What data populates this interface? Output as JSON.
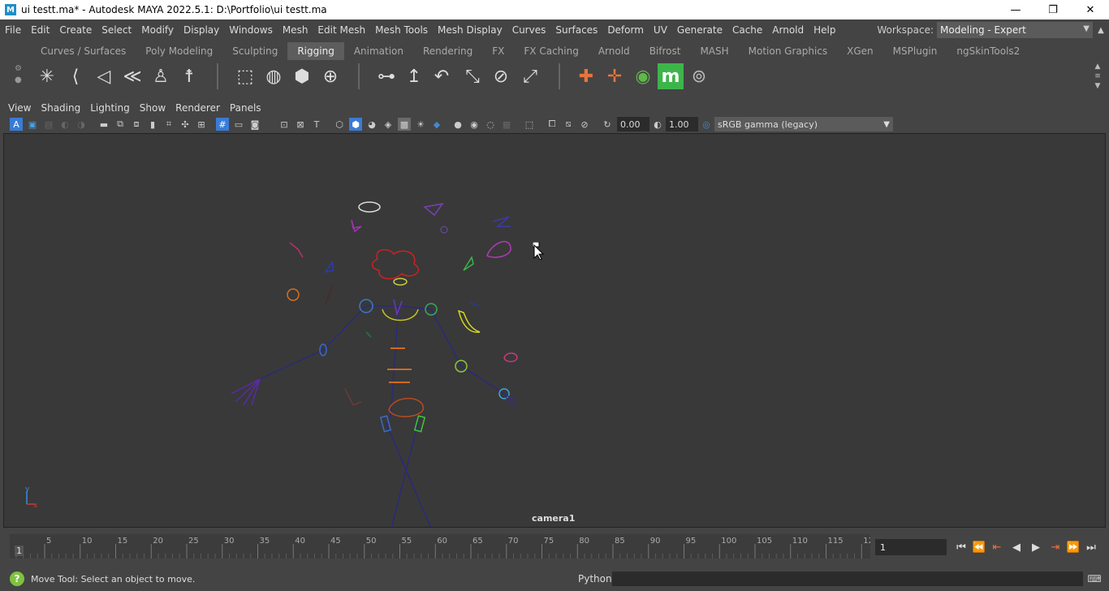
{
  "window": {
    "app_icon": "M",
    "title": "ui testt.ma* - Autodesk MAYA 2022.5.1: D:\\Portfolio\\ui testt.ma",
    "minimize": "—",
    "restore": "❐",
    "close": "✕"
  },
  "menu": {
    "items": [
      "File",
      "Edit",
      "Create",
      "Select",
      "Modify",
      "Display",
      "Windows",
      "Mesh",
      "Edit Mesh",
      "Mesh Tools",
      "Mesh Display",
      "Curves",
      "Surfaces",
      "Deform",
      "UV",
      "Generate",
      "Cache",
      "Arnold",
      "Help"
    ],
    "workspace_label": "Workspace:",
    "workspace_value": "Modeling - Expert"
  },
  "shelf_tabs": {
    "items": [
      "Curves / Surfaces",
      "Poly Modeling",
      "Sculpting",
      "Rigging",
      "Animation",
      "Rendering",
      "FX",
      "FX Caching",
      "Arnold",
      "Bifrost",
      "MASH",
      "Motion Graphics",
      "XGen",
      "MSPlugin",
      "ngSkinTools2"
    ],
    "active": "Rigging"
  },
  "shelf_icons": [
    "joint-tool-icon",
    "ik-handle-icon",
    "ik-spline-icon",
    "bind-skin-icon",
    "humanik-icon",
    "quick-rig-icon",
    "cluster-icon",
    "lattice-icon",
    "wire-icon",
    "soft-mod-icon",
    "point-constraint-icon",
    "aim-constraint-icon",
    "orient-constraint-icon",
    "scale-constraint-icon",
    "parent-constraint-icon",
    "pole-vector-icon",
    "locator-icon",
    "locator-add-icon",
    "ngskin-icon",
    "mash-m-icon",
    "fingerprint-icon"
  ],
  "panel_menu": [
    "View",
    "Shading",
    "Lighting",
    "Show",
    "Renderer",
    "Panels"
  ],
  "panel_toolbar": {
    "exposure": "0.00",
    "gamma": "1.00",
    "color_space": "sRGB gamma (legacy)"
  },
  "viewport": {
    "camera_label": "camera1",
    "axis_y": "y",
    "axis_x": "x"
  },
  "timeline": {
    "start_frame": "1",
    "ticks": [
      "5",
      "10",
      "15",
      "20",
      "25",
      "30",
      "35",
      "40",
      "45",
      "50",
      "55",
      "60",
      "65",
      "70",
      "75",
      "80",
      "85",
      "90",
      "95",
      "100",
      "105",
      "110",
      "115",
      "12"
    ],
    "current_frame": "1"
  },
  "playback": {
    "go_start": "⏮",
    "step_back_key": "⏪",
    "step_back_frame": "⇤",
    "play_back": "◀",
    "play_fwd": "▶",
    "step_fwd_frame": "⇥",
    "step_fwd_key": "⏩",
    "go_end": "⏭"
  },
  "status": {
    "help_icon": "?",
    "help_text": "Move Tool: Select an object to move.",
    "language": "Python"
  },
  "colors": {
    "background": "#444444",
    "viewport": "#393939",
    "accent_green": "#7fc242"
  }
}
